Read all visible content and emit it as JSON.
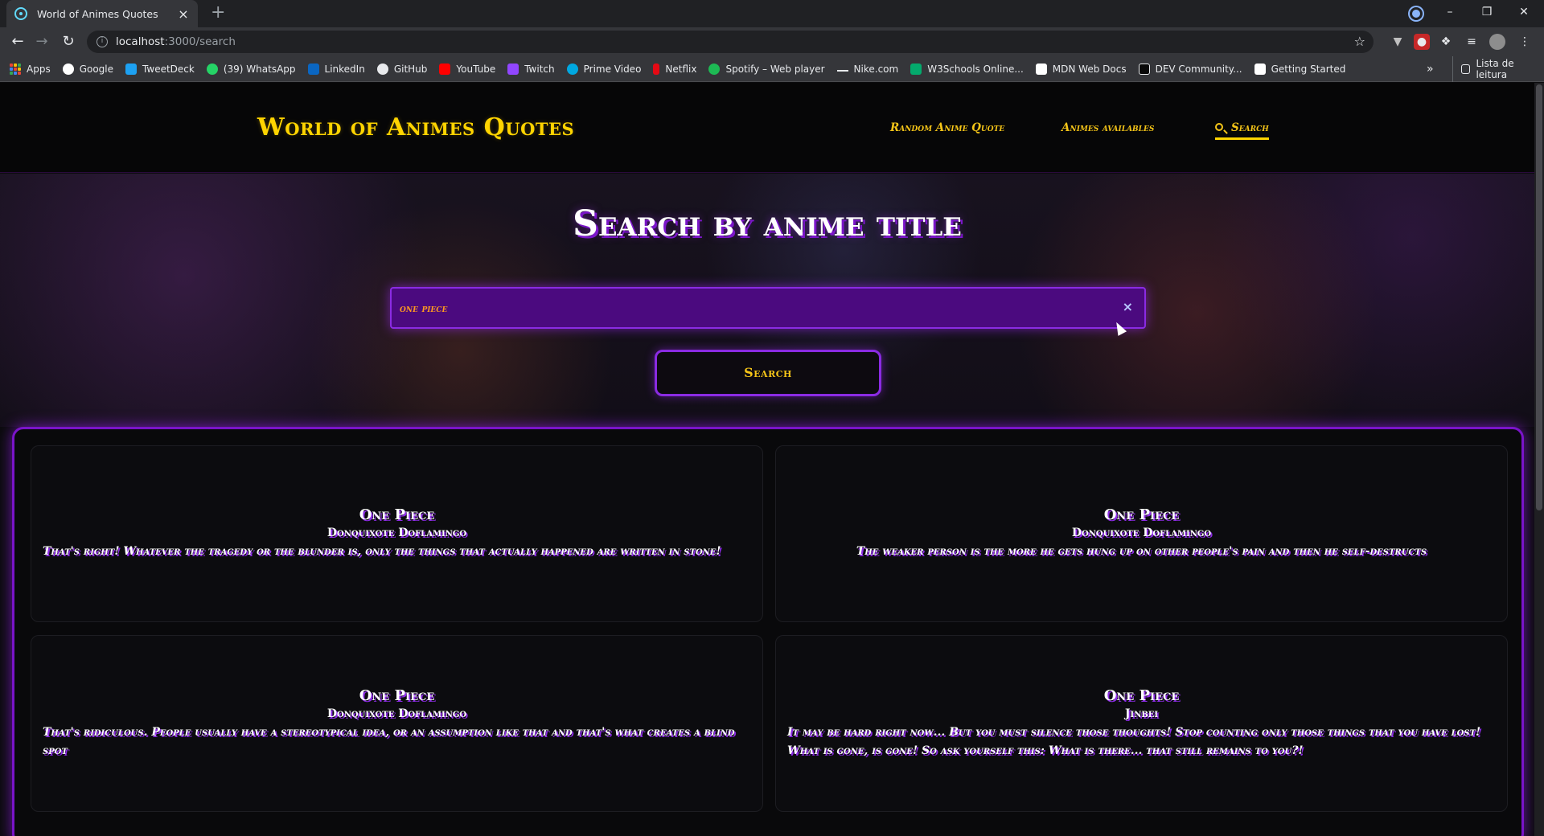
{
  "browser": {
    "tab_title": "World of Animes Quotes",
    "url_host": "localhost",
    "url_path": ":3000/search",
    "bookmarks": [
      "Apps",
      "Google",
      "TweetDeck",
      "(39) WhatsApp",
      "LinkedIn",
      "GitHub",
      "YouTube",
      "Twitch",
      "Prime Video",
      "Netflix",
      "Spotify – Web player",
      "Nike.com",
      "W3Schools Online...",
      "MDN Web Docs",
      "DEV Community...",
      "Getting Started"
    ],
    "bookmark_more": "»",
    "reading_list": "Lista de leitura"
  },
  "header": {
    "logo": "World of Animes Quotes",
    "nav": [
      "Random Anime Quote",
      "Animes availables",
      "Search"
    ]
  },
  "hero": {
    "title": "Search by anime title",
    "search_value": "one piece",
    "clear_icon": "×",
    "search_button": "Search"
  },
  "results": [
    {
      "anime": "One Piece",
      "character": "Donquixote Doflamingo",
      "quote": "That's right! Whatever the tragedy or the blunder is, only the things that actually happened are written in stone!"
    },
    {
      "anime": "One Piece",
      "character": "Donquixote Doflamingo",
      "quote": "The weaker person is the more he gets hung up on other people's pain and then he self-destructs"
    },
    {
      "anime": "One Piece",
      "character": "Donquixote Doflamingo",
      "quote": "That's ridiculous. People usually have a stereotypical idea, or an assumption like that and that's what creates a blind spot"
    },
    {
      "anime": "One Piece",
      "character": "Jinbei",
      "quote": "It may be hard right now... But you must silence those thoughts! Stop counting only those things that you have lost! What is gone, is gone! So ask yourself this: What is there... that still remains to you?!"
    }
  ],
  "colors": {
    "accent_yellow": "#ffd400",
    "accent_purple": "#8a2be2",
    "input_bg": "#4b0a7f"
  }
}
